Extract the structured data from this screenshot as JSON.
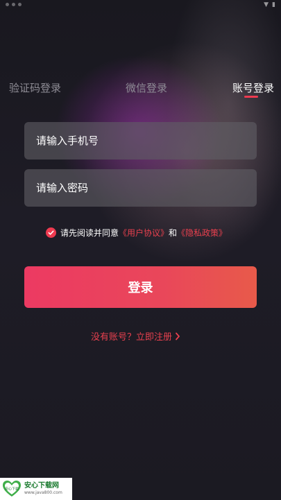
{
  "tabs": [
    {
      "label": "验证码登录",
      "active": false
    },
    {
      "label": "微信登录",
      "active": false
    },
    {
      "label": "账号登录",
      "active": true
    }
  ],
  "form": {
    "phone_placeholder": "请输入手机号",
    "password_placeholder": "请输入密码"
  },
  "agreement": {
    "prefix": "请先阅读并同意",
    "user_agreement": "《用户协议》",
    "conjunction": "和",
    "privacy_policy": "《隐私政策》",
    "checked": true
  },
  "login_button": "登录",
  "register_link": "没有账号？立即注册",
  "watermark": {
    "title": "安心下载网",
    "url": "www.java800.com",
    "logo_text": "安心下载"
  },
  "colors": {
    "accent": "#ee3a50",
    "background": "#1b1a22",
    "field_bg": "#5f5d64"
  }
}
